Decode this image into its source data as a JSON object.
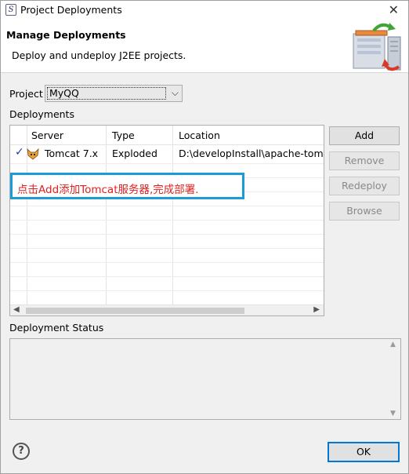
{
  "window": {
    "title": "Project Deployments",
    "close": "✕"
  },
  "header": {
    "title": "Manage Deployments",
    "description": "Deploy and undeploy J2EE projects.",
    "graphic_icon": "deploy-server-icon"
  },
  "project": {
    "label": "Project",
    "selected": "MyQQ"
  },
  "deployments": {
    "label": "Deployments",
    "columns": [
      "Server",
      "Type",
      "Location"
    ],
    "rows": [
      {
        "status": "✓",
        "server": "Tomcat  7.x",
        "type": "Exploded",
        "location": "D:\\developInstall\\apache-tomca"
      }
    ]
  },
  "annotation": {
    "text": "点击Add添加Tomcat服务器,完成部署."
  },
  "buttons": {
    "add": "Add",
    "remove": "Remove",
    "redeploy": "Redeploy",
    "browse": "Browse",
    "ok": "OK"
  },
  "status": {
    "label": "Deployment Status"
  },
  "help": {
    "glyph": "?"
  }
}
